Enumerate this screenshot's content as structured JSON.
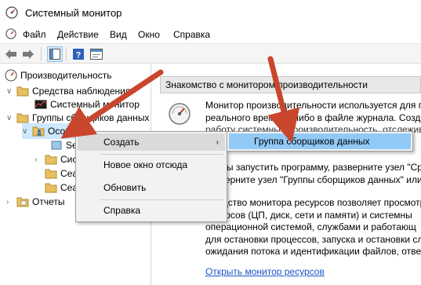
{
  "window": {
    "title": "Системный монитор"
  },
  "menubar": {
    "items": [
      "Файл",
      "Действие",
      "Вид",
      "Окно",
      "Справка"
    ]
  },
  "toolbar": {
    "buttons": [
      "back-icon",
      "forward-icon",
      "show-hide-tree-icon",
      "help-icon",
      "properties-icon"
    ]
  },
  "tree": {
    "items": [
      {
        "label": "Производительность"
      },
      {
        "label": "Средства наблюдения"
      },
      {
        "label": "Системный монитор"
      },
      {
        "label": "Группы сборщиков данных"
      },
      {
        "label": "Особые"
      },
      {
        "label": "Se"
      },
      {
        "label": "Систе"
      },
      {
        "label": "Сеанс"
      },
      {
        "label": "Сеанс"
      },
      {
        "label": "Отчеты"
      }
    ]
  },
  "panel": {
    "header": "Знакомство с монитором производительности",
    "intro_lines": [
      "Монитор производительности используется для п",
      "реального времени либо в файле журнала. Создав",
      "работу системных производительность, отслежив"
    ],
    "mid_lines": [
      "Чтобы запустить программу, разверните узел \"Сре",
      "разверните узел \"Группы сборщиков данных\" или"
    ],
    "resource_lines": [
      "Средство монитора ресурсов позволяет просмотр",
      "ресурсов (ЦП, диск, сети и памяти) и системны",
      "операционной системой, службами и работающ",
      "для остановки процессов, запуска и остановки служб",
      "ожидания потока и идентификации файлов, ответ"
    ],
    "link": "Открыть монитор ресурсов"
  },
  "context_menu": {
    "create": "Создать",
    "new_window": "Новое окно отсюда",
    "refresh": "Обновить",
    "help": "Справка"
  },
  "submenu": {
    "item": "Группа сборщиков данных"
  },
  "colors": {
    "selection": "#cde8ff",
    "submenu_highlight": "#91c9f7",
    "arrow": "#c9462d",
    "link": "#1a56c7"
  }
}
